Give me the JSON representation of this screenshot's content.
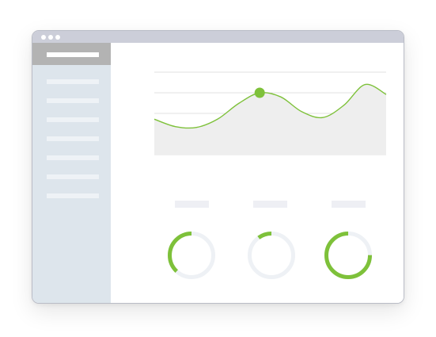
{
  "window": {
    "titlebar_buttons": [
      "dot",
      "dot",
      "dot"
    ]
  },
  "sidebar": {
    "header": "placeholder-bar",
    "items": [
      "placeholder-bar",
      "placeholder-bar",
      "placeholder-bar",
      "placeholder-bar",
      "placeholder-bar",
      "placeholder-bar",
      "placeholder-bar"
    ]
  },
  "colors": {
    "accent": "#7ec13a",
    "titlebar": "#ccced9",
    "sidebar": "#dde5ec",
    "sidebar_header": "#b3b3b3",
    "track": "#eef1f5",
    "area_fill": "#eeeeee",
    "grid": "#e2e2e2"
  },
  "chart_data": {
    "type": "area",
    "grid": true,
    "highlighted_point_index": 5,
    "series": [
      {
        "values": [
          0.43,
          0.34,
          0.33,
          0.43,
          0.62,
          0.75,
          0.7,
          0.52,
          0.45,
          0.6,
          0.85,
          0.73
        ]
      }
    ]
  },
  "metrics": [
    {
      "label": "placeholder-bar",
      "progress": 0.38
    },
    {
      "label": "placeholder-bar",
      "progress": 0.1
    },
    {
      "label": "placeholder-bar",
      "progress": 0.75
    }
  ]
}
